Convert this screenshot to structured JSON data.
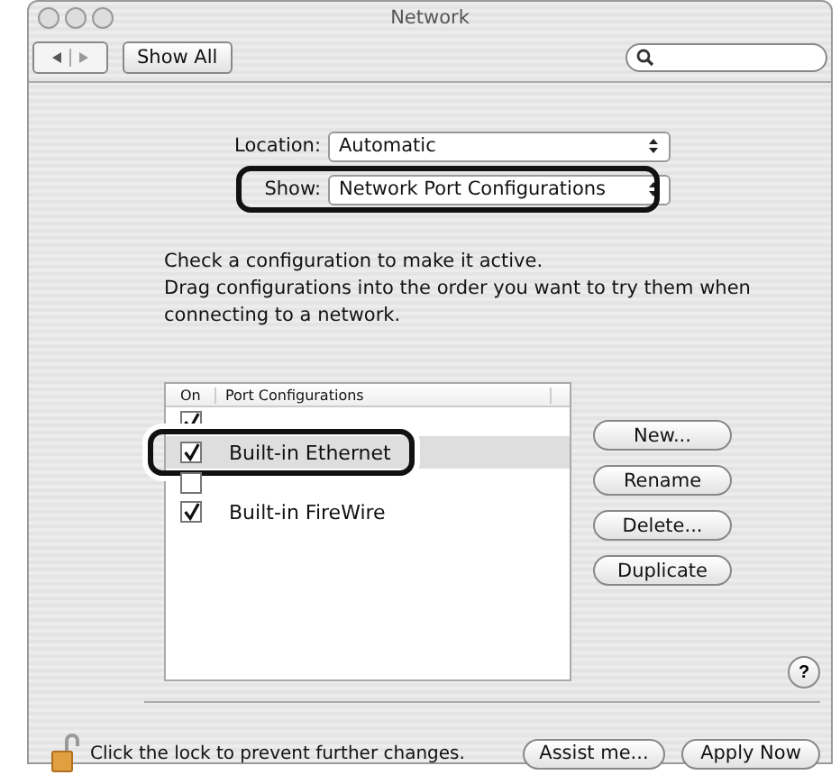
{
  "window": {
    "title": "Network"
  },
  "toolbar": {
    "show_all": "Show All"
  },
  "location": {
    "label": "Location:",
    "value": "Automatic"
  },
  "show": {
    "label": "Show:",
    "value": "Network Port Configurations",
    "highlighted": true
  },
  "instructions": [
    "Check a configuration to make it active.",
    "Drag configurations into the order you want to try them when connecting to a network."
  ],
  "table": {
    "columns": [
      "On",
      "Port Configurations"
    ],
    "rows": [
      {
        "checked": true,
        "selected": false,
        "highlighted": false
      },
      {
        "name": "Built-in Ethernet",
        "checked": true,
        "selected": true,
        "highlighted": true
      },
      {
        "checked": false,
        "selected": false,
        "highlighted": false
      },
      {
        "name": "Built-in FireWire",
        "checked": true,
        "selected": false,
        "highlighted": false
      }
    ]
  },
  "buttons": [
    "New...",
    "Rename",
    "Delete...",
    "Duplicate"
  ],
  "help": "?",
  "lock_text": "Click the lock to prevent further changes.",
  "footer_buttons": [
    "Assist me...",
    "Apply Now"
  ]
}
